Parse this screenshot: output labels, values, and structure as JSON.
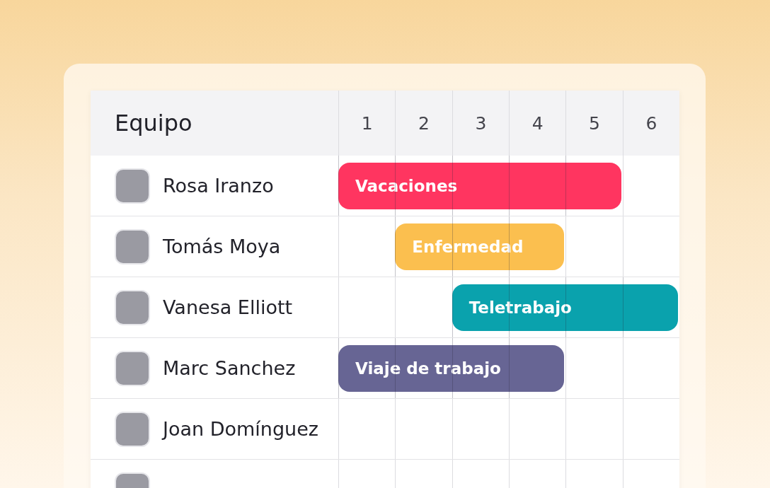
{
  "schedule": {
    "title": "Equipo",
    "days": [
      "1",
      "2",
      "3",
      "4",
      "5",
      "6"
    ],
    "rows": [
      {
        "kind": "member",
        "name": "Rosa Iranzo",
        "event": {
          "label": "Vacaciones",
          "color": "#ff3560",
          "covers": [
            true,
            true,
            true,
            true,
            true,
            false
          ]
        }
      },
      {
        "kind": "member",
        "name": "Tomás Moya",
        "event": {
          "label": "Enfermedad",
          "color": "#fbbf4f",
          "covers": [
            false,
            true,
            true,
            true,
            false,
            false
          ]
        }
      },
      {
        "kind": "member",
        "name": "Vanesa Elliott",
        "event": {
          "label": "Teletrabajo",
          "color": "#0aa2ad",
          "covers": [
            false,
            false,
            true,
            true,
            true,
            true
          ]
        }
      },
      {
        "kind": "member",
        "name": "Marc Sanchez",
        "event": {
          "label": "Viaje de trabajo",
          "color": "#676594",
          "covers": [
            true,
            true,
            true,
            true,
            false,
            false
          ]
        }
      },
      {
        "kind": "member",
        "name": "Joan Domínguez"
      },
      {
        "kind": "cut-off"
      }
    ]
  }
}
